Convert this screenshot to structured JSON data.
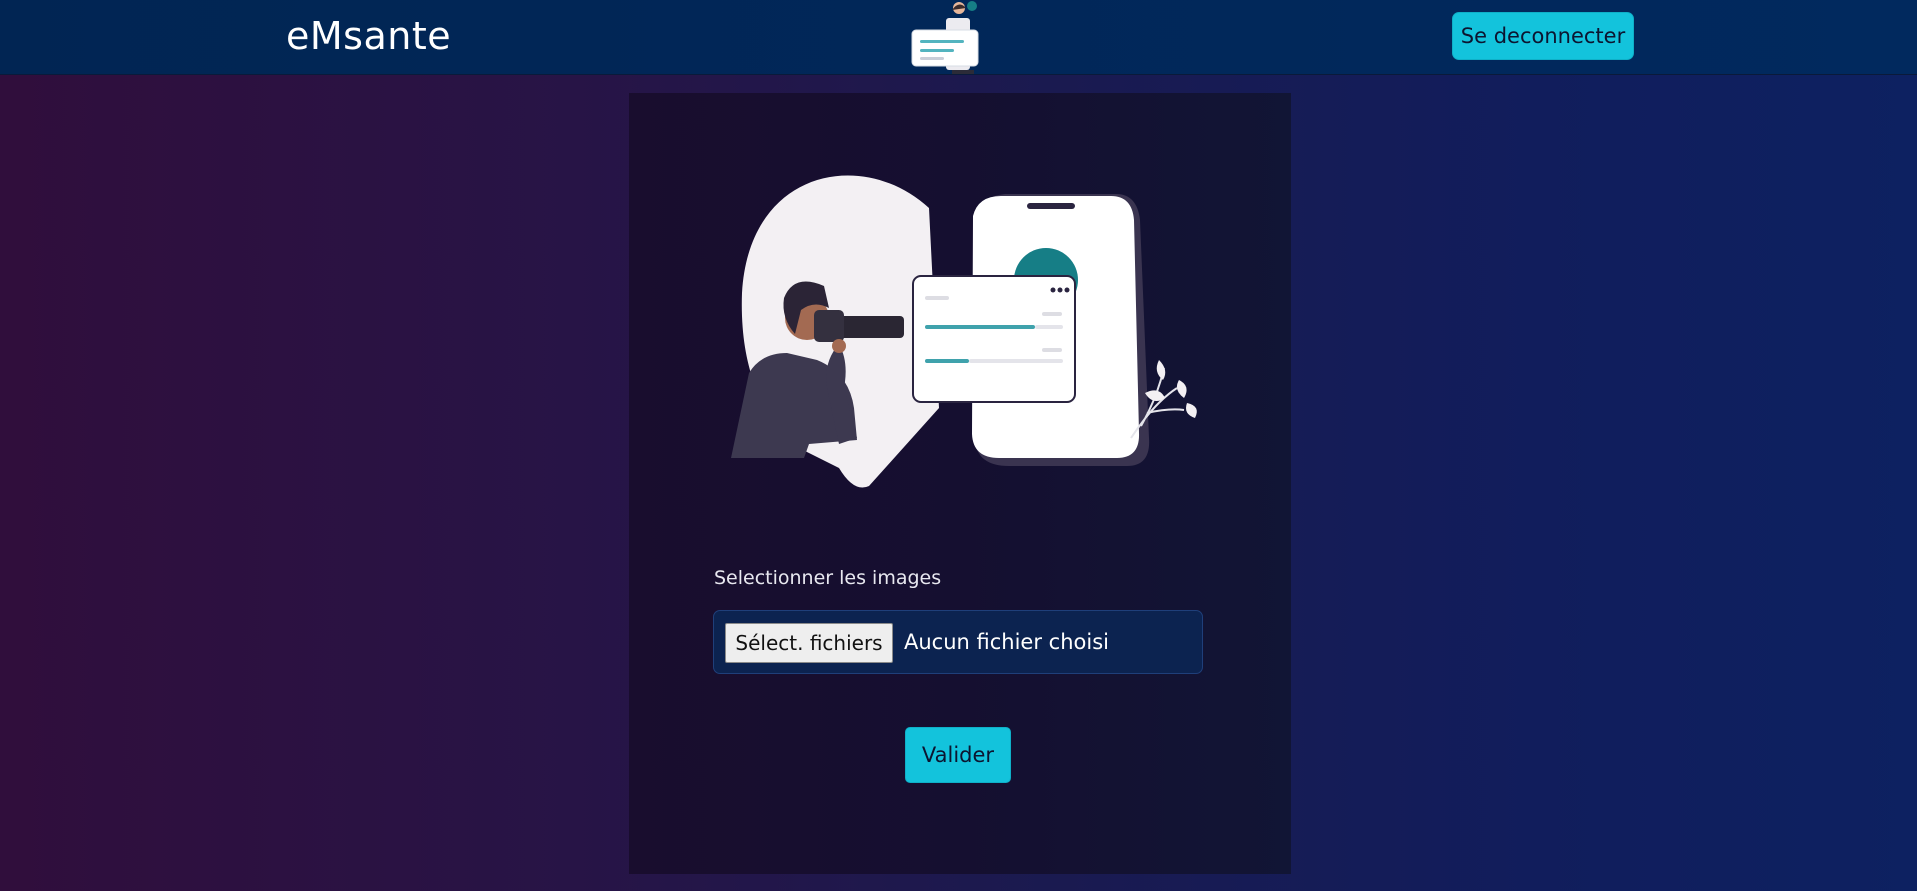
{
  "navbar": {
    "brand": "eMsante",
    "logout_label": "Se deconnecter"
  },
  "upload": {
    "label": "Selectionner les images",
    "file_button_label": "Sélect. fichiers",
    "file_status": "Aucun fichier choisi",
    "submit_label": "Valider"
  },
  "colors": {
    "accent": "#13c3dc",
    "navbar_bg": "#012553",
    "card_bg": "#170e30",
    "illustration_teal": "#167e86"
  },
  "icons": {
    "nav_logo": "document-checklist-illustration",
    "hero": "photographer-with-phone-illustration"
  }
}
